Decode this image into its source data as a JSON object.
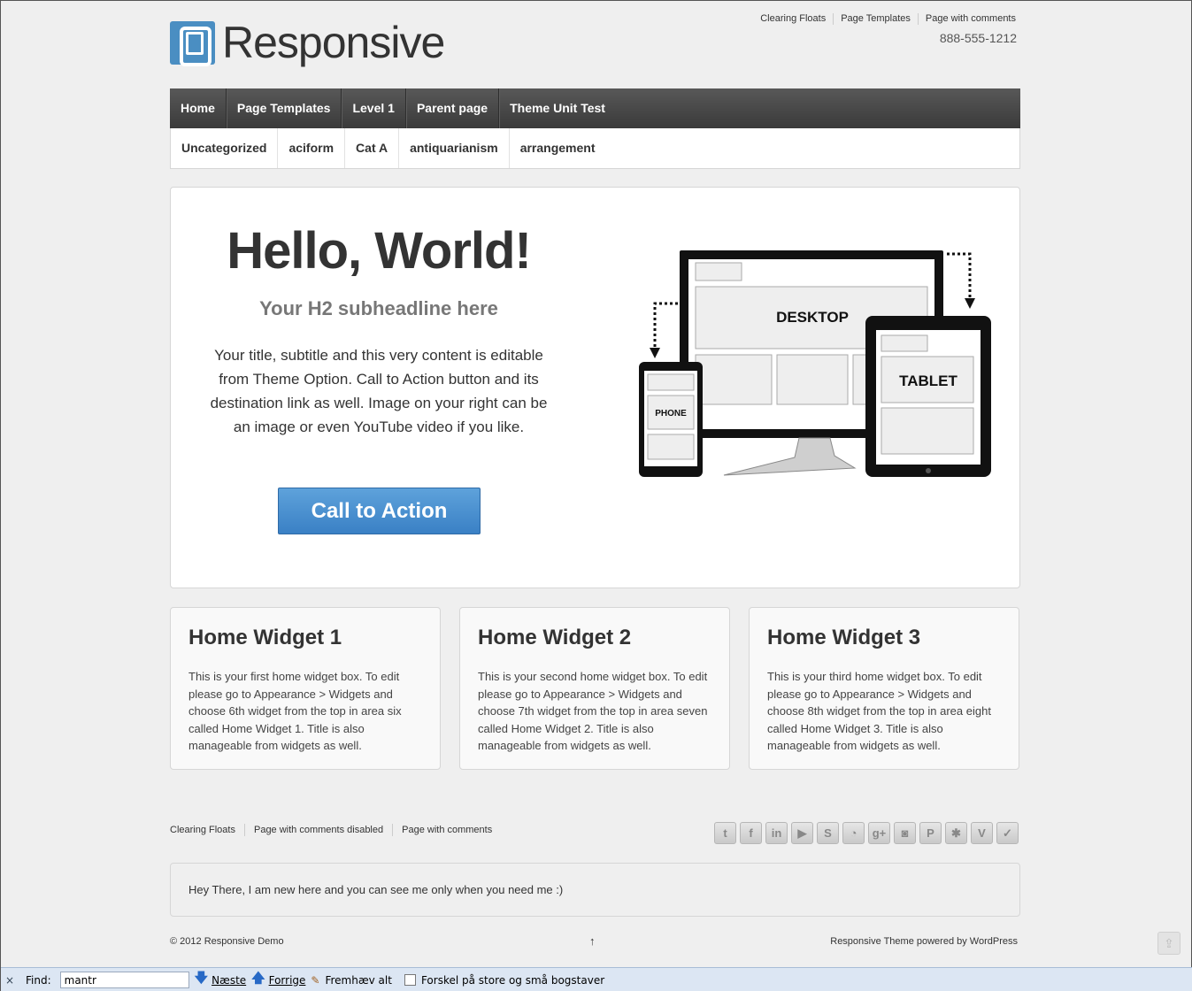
{
  "header": {
    "logo_text": "Responsive",
    "top_menu": [
      "Clearing Floats",
      "Page Templates",
      "Page with comments"
    ],
    "phone": "888-555-1212"
  },
  "main_nav": [
    "Home",
    "Page Templates",
    "Level 1",
    "Parent page",
    "Theme Unit Test"
  ],
  "sub_nav": [
    "Uncategorized",
    "aciform",
    "Cat A",
    "antiquarianism",
    "arrangement"
  ],
  "hero": {
    "title": "Hello, World!",
    "subtitle": "Your H2 subheadline here",
    "content": "Your title, subtitle and this very content is editable from Theme Option. Call to Action button and its destination link as well. Image on your right can be an image or even YouTube video if you like.",
    "cta_label": "Call to Action",
    "image_labels": {
      "desktop": "DESKTOP",
      "tablet": "TABLET",
      "phone": "PHONE"
    }
  },
  "widgets": [
    {
      "title": "Home Widget 1",
      "text": "This is your first home widget box. To edit please go to Appearance > Widgets and choose 6th widget from the top in area six called Home Widget 1. Title is also manageable from widgets as well."
    },
    {
      "title": "Home Widget 2",
      "text": "This is your second home widget box. To edit please go to Appearance > Widgets and choose 7th widget from the top in area seven called Home Widget 2. Title is also manageable from widgets as well."
    },
    {
      "title": "Home Widget 3",
      "text": "This is your third home widget box. To edit please go to Appearance > Widgets and choose 8th widget from the top in area eight called Home Widget 3. Title is also manageable from widgets as well."
    }
  ],
  "footer": {
    "menu": [
      "Clearing Floats",
      "Page with comments disabled",
      "Page with comments"
    ],
    "social_icons": [
      "twitter-icon",
      "facebook-icon",
      "linkedin-icon",
      "youtube-icon",
      "stumbleupon-icon",
      "rss-icon",
      "google-plus-icon",
      "instagram-icon",
      "pinterest-icon",
      "yelp-icon",
      "vimeo-icon",
      "foursquare-icon"
    ],
    "colophon_text": "Hey There, I am new here and you can see me only when you need me :)",
    "copyright": "© 2012 Responsive Demo",
    "scroll_top": "↑",
    "powered_by": "Responsive Theme powered by WordPress"
  },
  "findbar": {
    "close": "×",
    "label": "Find:",
    "value": "mantr",
    "next_label": "Næste",
    "prev_label": "Forrige",
    "highlight_label": "Fremhæv alt",
    "match_case_label": "Forskel på store og små bogstaver"
  },
  "colors": {
    "nav_bg": "#484848",
    "cta_blue": "#4a90d0",
    "logo_blue": "#4a8ec2",
    "page_bg": "#efefef"
  }
}
